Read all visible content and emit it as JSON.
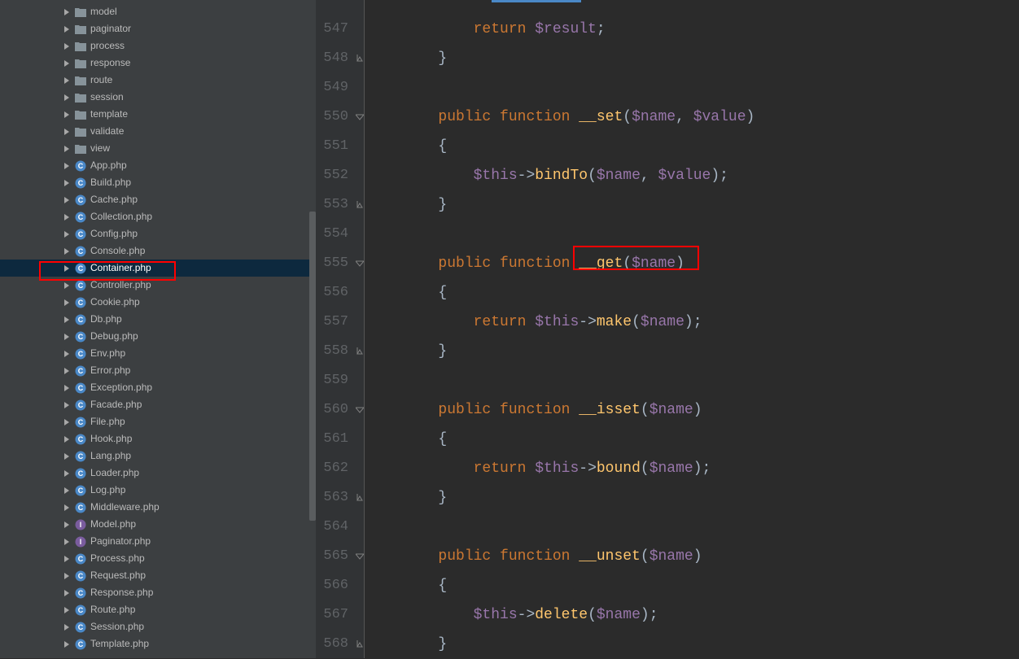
{
  "sidebar": {
    "items": [
      {
        "label": "model",
        "type": "folder"
      },
      {
        "label": "paginator",
        "type": "folder"
      },
      {
        "label": "process",
        "type": "folder"
      },
      {
        "label": "response",
        "type": "folder"
      },
      {
        "label": "route",
        "type": "folder"
      },
      {
        "label": "session",
        "type": "folder"
      },
      {
        "label": "template",
        "type": "folder"
      },
      {
        "label": "validate",
        "type": "folder"
      },
      {
        "label": "view",
        "type": "folder"
      },
      {
        "label": "App.php",
        "type": "class"
      },
      {
        "label": "Build.php",
        "type": "class"
      },
      {
        "label": "Cache.php",
        "type": "class"
      },
      {
        "label": "Collection.php",
        "type": "class"
      },
      {
        "label": "Config.php",
        "type": "class"
      },
      {
        "label": "Console.php",
        "type": "class"
      },
      {
        "label": "Container.php",
        "type": "class",
        "selected": true
      },
      {
        "label": "Controller.php",
        "type": "class"
      },
      {
        "label": "Cookie.php",
        "type": "class"
      },
      {
        "label": "Db.php",
        "type": "class"
      },
      {
        "label": "Debug.php",
        "type": "class"
      },
      {
        "label": "Env.php",
        "type": "class"
      },
      {
        "label": "Error.php",
        "type": "class"
      },
      {
        "label": "Exception.php",
        "type": "class"
      },
      {
        "label": "Facade.php",
        "type": "class"
      },
      {
        "label": "File.php",
        "type": "class"
      },
      {
        "label": "Hook.php",
        "type": "class"
      },
      {
        "label": "Lang.php",
        "type": "class"
      },
      {
        "label": "Loader.php",
        "type": "class"
      },
      {
        "label": "Log.php",
        "type": "class"
      },
      {
        "label": "Middleware.php",
        "type": "class"
      },
      {
        "label": "Model.php",
        "type": "interface"
      },
      {
        "label": "Paginator.php",
        "type": "interface"
      },
      {
        "label": "Process.php",
        "type": "class"
      },
      {
        "label": "Request.php",
        "type": "class"
      },
      {
        "label": "Response.php",
        "type": "class"
      },
      {
        "label": "Route.php",
        "type": "class"
      },
      {
        "label": "Session.php",
        "type": "class"
      },
      {
        "label": "Template.php",
        "type": "class"
      }
    ]
  },
  "editor": {
    "lines": [
      {
        "num": "547",
        "tokens": [
          [
            "            ",
            "plain"
          ],
          [
            "return ",
            "keyword"
          ],
          [
            "$result",
            "var"
          ],
          [
            ";",
            "plain"
          ]
        ]
      },
      {
        "num": "548",
        "tokens": [
          [
            "        }",
            "plain"
          ]
        ],
        "fold": "end"
      },
      {
        "num": "549",
        "tokens": [
          [
            "",
            "plain"
          ]
        ]
      },
      {
        "num": "550",
        "tokens": [
          [
            "        ",
            "plain"
          ],
          [
            "public function ",
            "keyword"
          ],
          [
            "__set",
            "magic"
          ],
          [
            "(",
            "plain"
          ],
          [
            "$name",
            "var"
          ],
          [
            ", ",
            "plain"
          ],
          [
            "$value",
            "var"
          ],
          [
            ")",
            "plain"
          ]
        ],
        "fold": "start"
      },
      {
        "num": "551",
        "tokens": [
          [
            "        {",
            "plain"
          ]
        ]
      },
      {
        "num": "552",
        "tokens": [
          [
            "            ",
            "plain"
          ],
          [
            "$this",
            "var"
          ],
          [
            "->",
            "op"
          ],
          [
            "bindTo",
            "func"
          ],
          [
            "(",
            "plain"
          ],
          [
            "$name",
            "var"
          ],
          [
            ", ",
            "plain"
          ],
          [
            "$value",
            "var"
          ],
          [
            ");",
            "plain"
          ]
        ]
      },
      {
        "num": "553",
        "tokens": [
          [
            "        }",
            "plain"
          ]
        ],
        "fold": "end"
      },
      {
        "num": "554",
        "tokens": [
          [
            "",
            "plain"
          ]
        ]
      },
      {
        "num": "555",
        "tokens": [
          [
            "        ",
            "plain"
          ],
          [
            "public function ",
            "keyword"
          ],
          [
            "__get",
            "magic"
          ],
          [
            "(",
            "plain"
          ],
          [
            "$name",
            "var"
          ],
          [
            ")",
            "plain"
          ]
        ],
        "fold": "start"
      },
      {
        "num": "556",
        "tokens": [
          [
            "        {",
            "plain"
          ]
        ]
      },
      {
        "num": "557",
        "tokens": [
          [
            "            ",
            "plain"
          ],
          [
            "return ",
            "keyword"
          ],
          [
            "$this",
            "var"
          ],
          [
            "->",
            "op"
          ],
          [
            "make",
            "func"
          ],
          [
            "(",
            "plain"
          ],
          [
            "$name",
            "var"
          ],
          [
            ");",
            "plain"
          ]
        ]
      },
      {
        "num": "558",
        "tokens": [
          [
            "        }",
            "plain"
          ]
        ],
        "fold": "end"
      },
      {
        "num": "559",
        "tokens": [
          [
            "",
            "plain"
          ]
        ]
      },
      {
        "num": "560",
        "tokens": [
          [
            "        ",
            "plain"
          ],
          [
            "public function ",
            "keyword"
          ],
          [
            "__isset",
            "magic"
          ],
          [
            "(",
            "plain"
          ],
          [
            "$name",
            "var"
          ],
          [
            ")",
            "plain"
          ]
        ],
        "fold": "start"
      },
      {
        "num": "561",
        "tokens": [
          [
            "        {",
            "plain"
          ]
        ]
      },
      {
        "num": "562",
        "tokens": [
          [
            "            ",
            "plain"
          ],
          [
            "return ",
            "keyword"
          ],
          [
            "$this",
            "var"
          ],
          [
            "->",
            "op"
          ],
          [
            "bound",
            "func"
          ],
          [
            "(",
            "plain"
          ],
          [
            "$name",
            "var"
          ],
          [
            ");",
            "plain"
          ]
        ]
      },
      {
        "num": "563",
        "tokens": [
          [
            "        }",
            "plain"
          ]
        ],
        "fold": "end"
      },
      {
        "num": "564",
        "tokens": [
          [
            "",
            "plain"
          ]
        ]
      },
      {
        "num": "565",
        "tokens": [
          [
            "        ",
            "plain"
          ],
          [
            "public function ",
            "keyword"
          ],
          [
            "__unset",
            "magic"
          ],
          [
            "(",
            "plain"
          ],
          [
            "$name",
            "var"
          ],
          [
            ")",
            "plain"
          ]
        ],
        "fold": "start"
      },
      {
        "num": "566",
        "tokens": [
          [
            "        {",
            "plain"
          ]
        ]
      },
      {
        "num": "567",
        "tokens": [
          [
            "            ",
            "plain"
          ],
          [
            "$this",
            "var"
          ],
          [
            "->",
            "op"
          ],
          [
            "delete",
            "func"
          ],
          [
            "(",
            "plain"
          ],
          [
            "$name",
            "var"
          ],
          [
            ");",
            "plain"
          ]
        ]
      },
      {
        "num": "568",
        "tokens": [
          [
            "        }",
            "plain"
          ]
        ],
        "fold": "end"
      }
    ]
  },
  "colors": {
    "highlight_red": "#ff0000",
    "selection_bg": "#0d293e"
  }
}
